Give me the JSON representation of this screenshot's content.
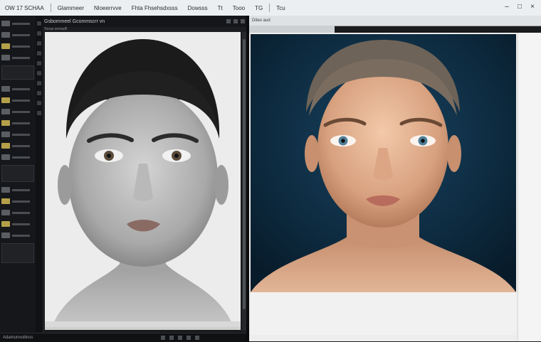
{
  "menubar": {
    "items": [
      "OW 17 SCHAA",
      "Glammeer",
      "Nloeerrvve",
      "Fhta Fhsehsdxsss",
      "Dowsss",
      "Tt",
      "Tooo",
      "TG",
      "Tcu"
    ]
  },
  "left_panel": {
    "title": "Gsbommeel Gcommscrr vn",
    "subtitle": "Tooas semadll"
  },
  "right_panel": {
    "header": "Diteo aud"
  },
  "statusbar": {
    "text": "Adamunvutlinss"
  },
  "colors": {
    "workspace_bg": "#1a1b1d",
    "right_bg": "#0b2a3f",
    "left_canvas_bg": "#ececec"
  }
}
